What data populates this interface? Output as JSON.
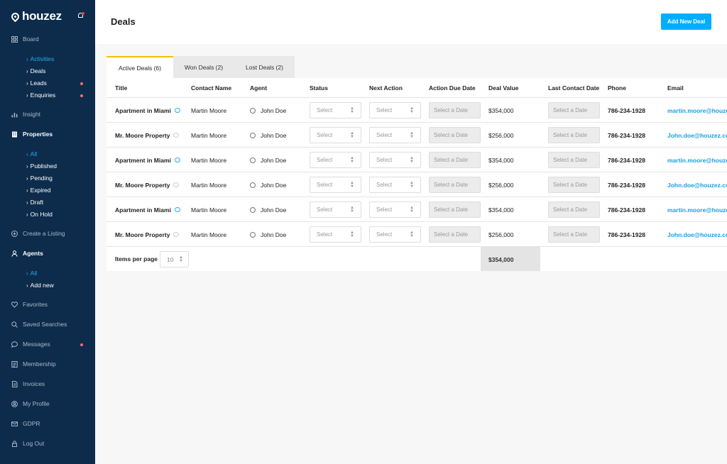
{
  "brand": {
    "name": "houzez"
  },
  "sidebar": {
    "board": "Board",
    "board_items": [
      {
        "label": "Activities",
        "current": true,
        "dot": false
      },
      {
        "label": "Deals",
        "current": false,
        "dot": false
      },
      {
        "label": "Leads",
        "current": false,
        "dot": true
      },
      {
        "label": "Enquiries",
        "current": false,
        "dot": true
      }
    ],
    "insight": "Insight",
    "properties": "Properties",
    "property_items": [
      {
        "label": "All",
        "current": true
      },
      {
        "label": "Published",
        "current": false
      },
      {
        "label": "Pending",
        "current": false
      },
      {
        "label": "Expired",
        "current": false
      },
      {
        "label": "Draft",
        "current": false
      },
      {
        "label": "On Hold",
        "current": false
      }
    ],
    "create_listing": "Create a Listing",
    "agents": "Agents",
    "agent_items": [
      {
        "label": "All",
        "current": true
      },
      {
        "label": "Add new",
        "current": false
      }
    ],
    "favorites": "Favorites",
    "saved_searches": "Saved Searches",
    "messages": "Messages",
    "membership": "Membership",
    "invoices": "Invoices",
    "my_profile": "My Profile",
    "gdpr": "GDPR",
    "log_out": "Log Out"
  },
  "header": {
    "title": "Deals",
    "add_button": "Add New Deal"
  },
  "tabs": [
    {
      "label": "Active Deals (6)",
      "active": true
    },
    {
      "label": "Won Deals (2)",
      "active": false
    },
    {
      "label": "Lost Deals (2)",
      "active": false
    }
  ],
  "table": {
    "columns": [
      "Title",
      "Contact Name",
      "Agent",
      "Status",
      "Next Action",
      "Action Due Date",
      "Deal Value",
      "Last Contact Date",
      "Phone",
      "Email"
    ],
    "select_placeholder": "Select",
    "date_placeholder": "Select a Date",
    "rows": [
      {
        "title": "Apartment in Miami",
        "contact": "Martin Moore",
        "agent": "John Doe",
        "value": "$354,000",
        "phone": "786-234-1928",
        "email": "martin.moore@houzez",
        "chat_active": true
      },
      {
        "title": "Mr. Moore Property",
        "contact": "Martin Moore",
        "agent": "John Doe",
        "value": "$256,000",
        "phone": "786-234-1928",
        "email": "John.doe@houzez.co",
        "chat_active": false
      },
      {
        "title": "Apartment in Miami",
        "contact": "Martin Moore",
        "agent": "John Doe",
        "value": "$354,000",
        "phone": "786-234-1928",
        "email": "martin.moore@houzez",
        "chat_active": true
      },
      {
        "title": "Mr. Moore Property",
        "contact": "Martin Moore",
        "agent": "John Doe",
        "value": "$256,000",
        "phone": "786-234-1928",
        "email": "John.doe@houzez.co",
        "chat_active": false
      },
      {
        "title": "Apartment in Miami",
        "contact": "Martin Moore",
        "agent": "John Doe",
        "value": "$354,000",
        "phone": "786-234-1928",
        "email": "martin.moore@houzez",
        "chat_active": true
      },
      {
        "title": "Mr. Moore Property",
        "contact": "Martin Moore",
        "agent": "John Doe",
        "value": "$256,000",
        "phone": "786-234-1928",
        "email": "John.doe@houzez.co",
        "chat_active": false
      }
    ],
    "footer": {
      "items_per_page_label": "Items per page",
      "items_per_page_value": "10",
      "total_value": "$354,000"
    }
  },
  "colors": {
    "sidebar_bg": "#0d2c4c",
    "accent_blue": "#00aeff",
    "tab_active_border": "#f5c000",
    "notification_dot": "#ff6b6b"
  }
}
